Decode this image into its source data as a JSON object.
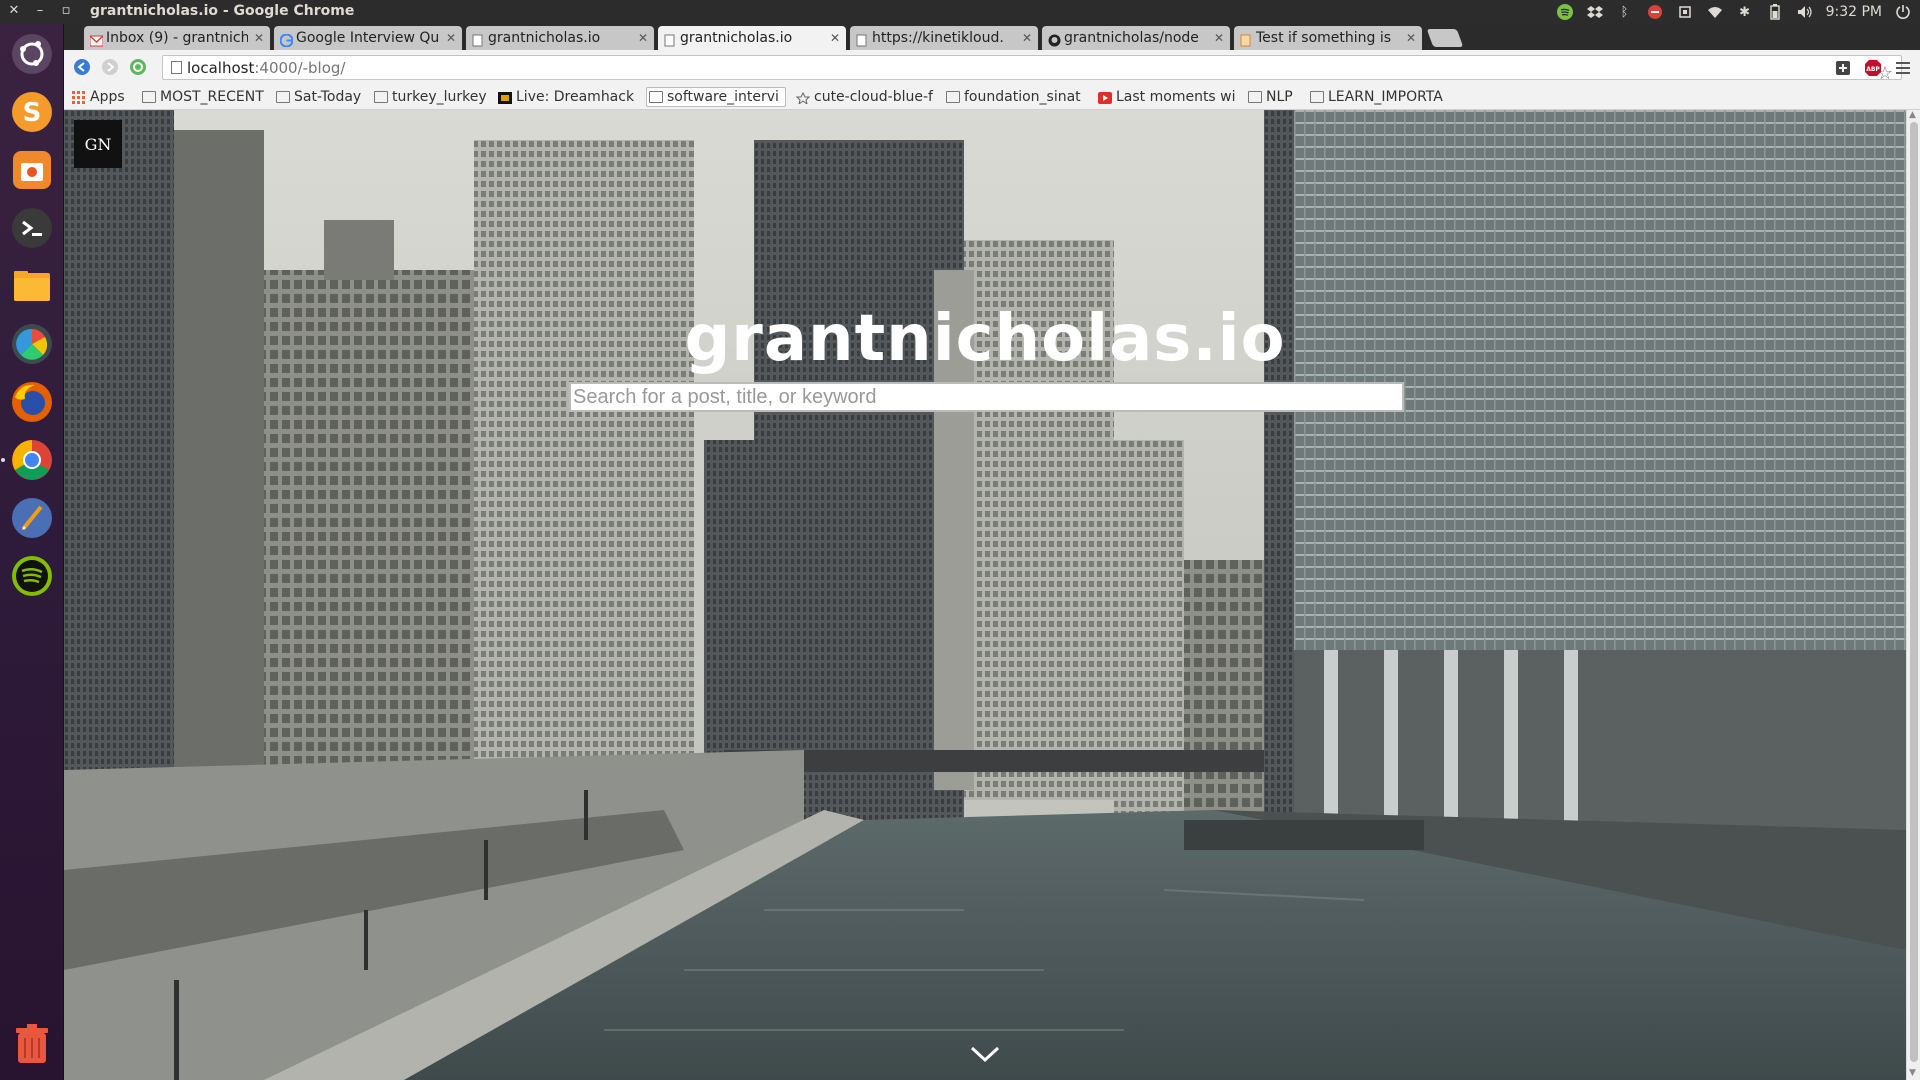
{
  "os": {
    "window_title": "grantnicholas.io - Google Chrome",
    "clock": "9:32 PM"
  },
  "tabs": [
    {
      "label": "Inbox (9) - grantnich",
      "icon": "gmail-icon",
      "active": false
    },
    {
      "label": "Google Interview Qu",
      "icon": "google-icon",
      "active": false
    },
    {
      "label": "grantnicholas.io",
      "icon": "page-icon",
      "active": false
    },
    {
      "label": "grantnicholas.io",
      "icon": "page-icon",
      "active": true
    },
    {
      "label": "https://kinetikloud.",
      "icon": "page-icon",
      "active": false
    },
    {
      "label": "grantnicholas/node",
      "icon": "github-icon",
      "active": false
    },
    {
      "label": "Test if something is",
      "icon": "page-icon",
      "active": false
    }
  ],
  "toolbar": {
    "url_host": "localhost",
    "url_path": ":4000/-blog/"
  },
  "bookmarks": [
    {
      "label": "Apps",
      "icon": "apps-grid-icon"
    },
    {
      "label": "MOST_RECENT",
      "icon": "folder-icon"
    },
    {
      "label": "Sat-Today",
      "icon": "folder-icon"
    },
    {
      "label": "turkey_lurkey",
      "icon": "folder-icon"
    },
    {
      "label": "Live: Dreamhack",
      "icon": "bookmark-favicon"
    },
    {
      "label": "software_intervi",
      "icon": "folder-icon"
    },
    {
      "label": "cute-cloud-blue-f",
      "icon": "bookmark-favicon"
    },
    {
      "label": "foundation_sinat",
      "icon": "folder-icon"
    },
    {
      "label": "Last moments wi",
      "icon": "youtube-icon"
    },
    {
      "label": "NLP",
      "icon": "folder-icon"
    },
    {
      "label": "LEARN_IMPORTA",
      "icon": "folder-icon"
    }
  ],
  "page": {
    "logo_text": "GN",
    "site_title": "grantnicholas.io",
    "search_placeholder": "Search for a post, title, or keyword"
  },
  "colors": {
    "launcher": "#2e1a3a",
    "tab_active": "#f2f2f2",
    "tab_inactive": "#c7c7c7",
    "hero_tone": "#8f958f"
  }
}
